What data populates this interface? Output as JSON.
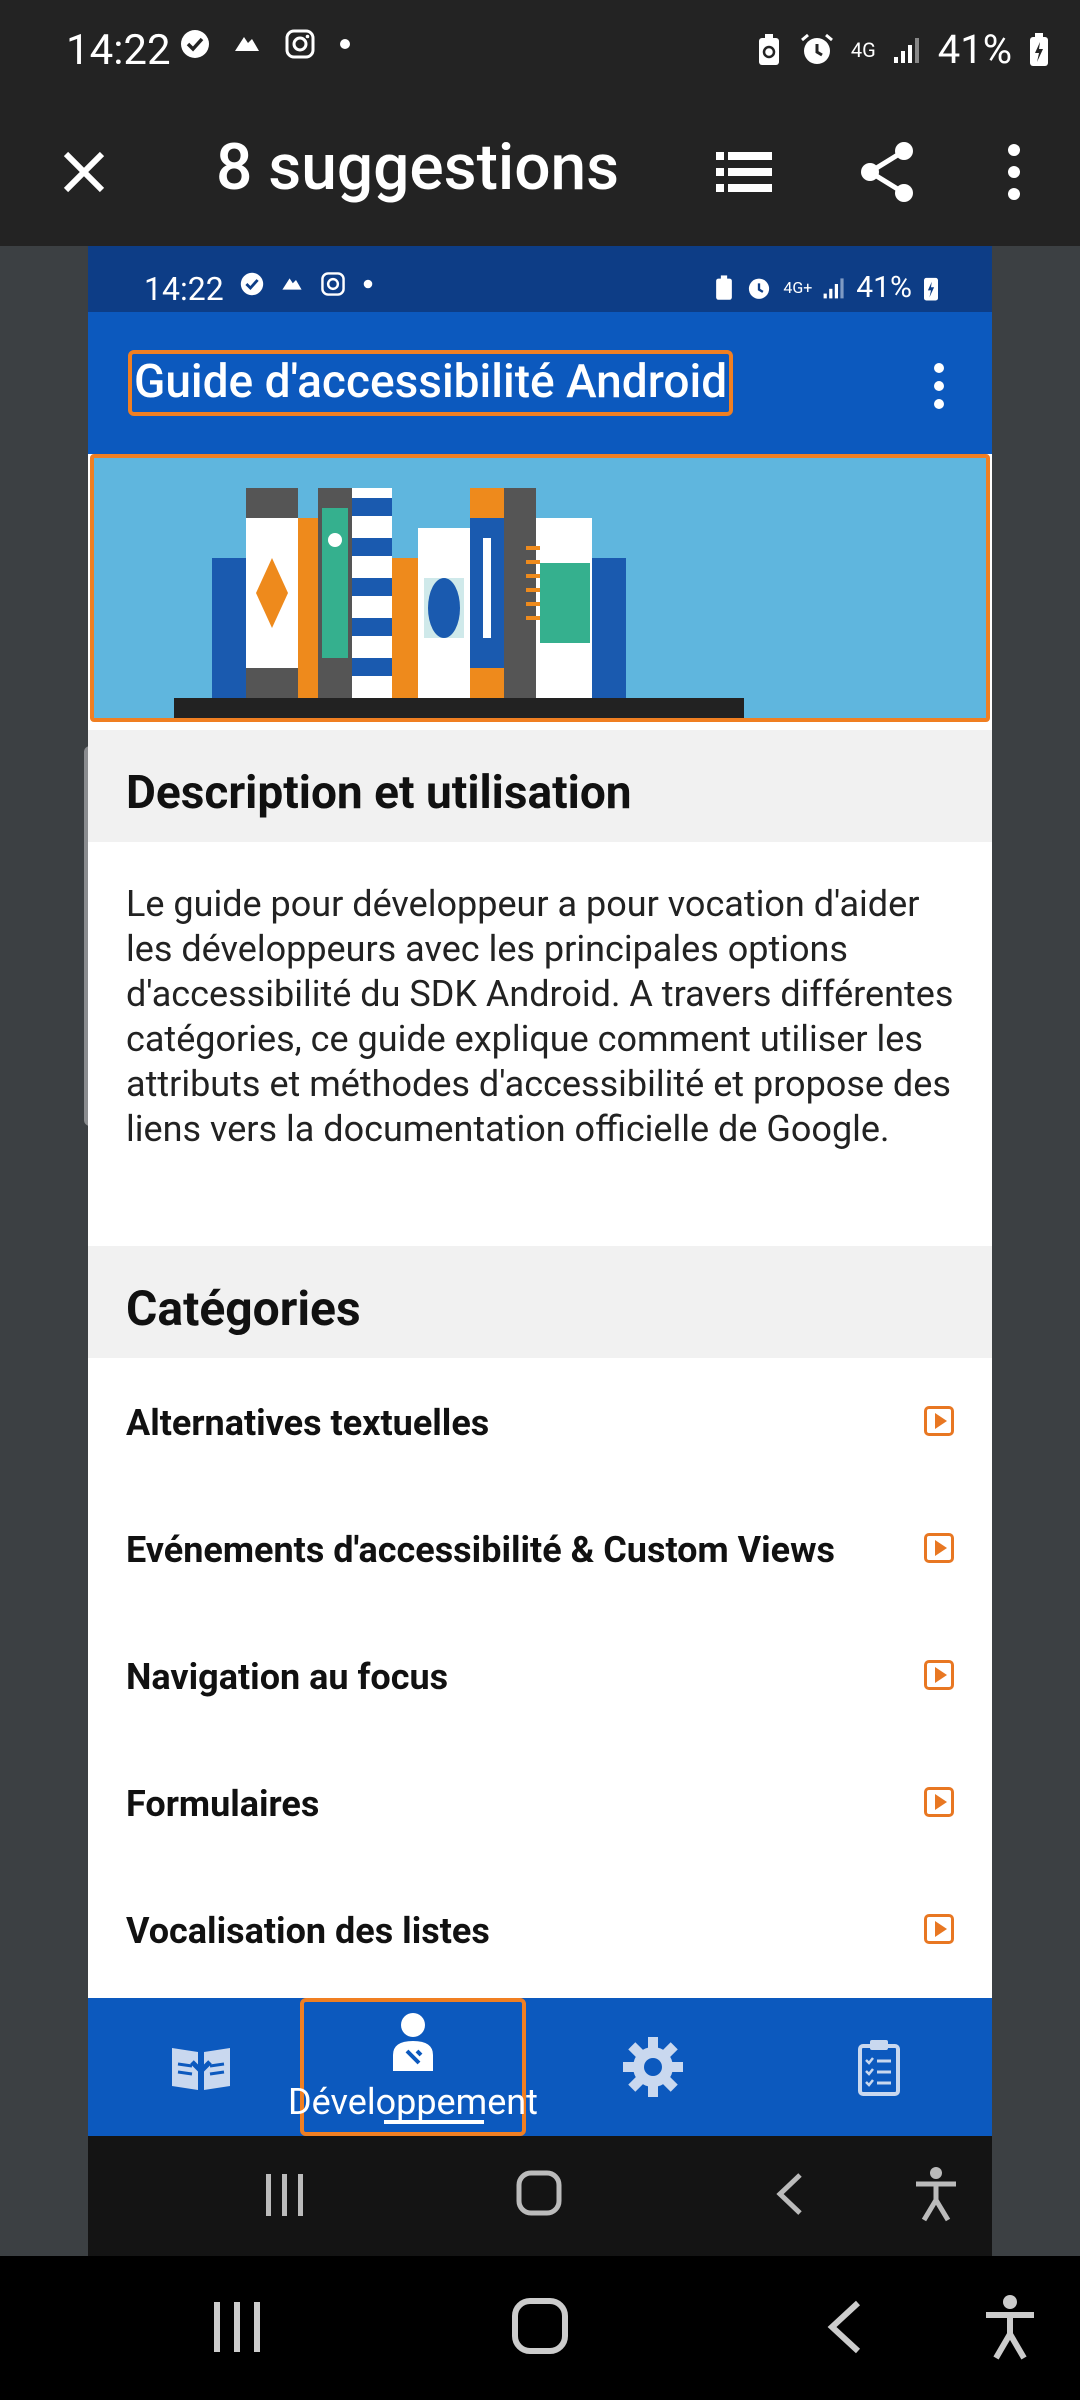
{
  "outer_status": {
    "time": "14:22",
    "battery": "41%",
    "network": "4G"
  },
  "outer_toolbar": {
    "title": "8 suggestions"
  },
  "inner_status": {
    "time": "14:22",
    "battery": "41%",
    "network": "4G+"
  },
  "app_bar": {
    "title": "Guide d'accessibilité Android"
  },
  "description": {
    "heading": "Description et utilisation",
    "text": "Le guide pour développeur a pour vocation d'aider les développeurs avec les principales options d'accessibilité du SDK Android. A travers différentes catégories, ce guide explique comment utiliser les attributs et méthodes d'accessibilité et propose des liens vers la documentation officielle de Google."
  },
  "categories": {
    "heading": "Catégories",
    "items": [
      {
        "label": "Alternatives textuelles"
      },
      {
        "label": "Evénements d'accessibilité & Custom Views"
      },
      {
        "label": "Navigation au focus"
      },
      {
        "label": "Formulaires"
      },
      {
        "label": "Vocalisation des listes"
      }
    ]
  },
  "bottom_nav": {
    "items": [
      {
        "icon": "book-download-icon",
        "label": ""
      },
      {
        "icon": "developer-icon",
        "label": "Développement",
        "active": true
      },
      {
        "icon": "gear-icon",
        "label": ""
      },
      {
        "icon": "clipboard-checklist-icon",
        "label": ""
      }
    ]
  },
  "colors": {
    "app_bar": "#0c59be",
    "inner_status": "#0d3d86",
    "highlight": "#f07f22",
    "banner": "#5fb6de",
    "outer_chrome": "#232323"
  }
}
